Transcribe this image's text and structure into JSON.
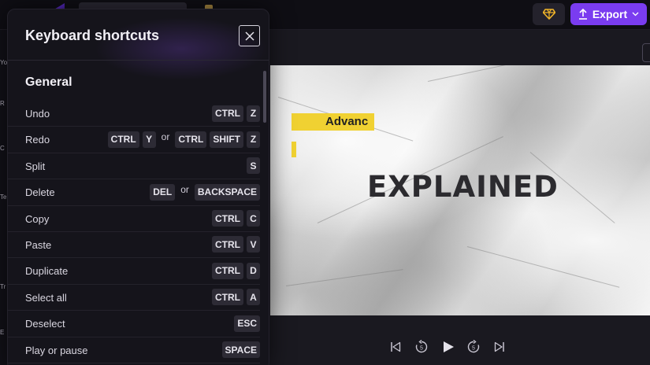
{
  "topbar": {
    "export_label": "Export",
    "icons": [
      "logo-icon",
      "diamond-icon",
      "upload-icon",
      "chevron-down-icon"
    ],
    "accent": "#7a3cf0",
    "premium_color": "#f0b429"
  },
  "rail": {
    "labels": [
      "Yo",
      "R",
      "C",
      "Te",
      "Tr",
      "E"
    ]
  },
  "preview": {
    "highlight_text": "Advanc",
    "headline": "EXPLAINED",
    "highlight_color": "#f0d132"
  },
  "controls": {
    "icons": [
      "skip-back-icon",
      "rewind-5-icon",
      "play-icon",
      "forward-5-icon",
      "skip-forward-icon"
    ],
    "rewind_label": "5",
    "forward_label": "5"
  },
  "panel": {
    "title": "Keyboard shortcuts",
    "section": "General",
    "rows": [
      {
        "name": "Undo",
        "groups": [
          [
            "CTRL",
            "Z"
          ]
        ]
      },
      {
        "name": "Redo",
        "groups": [
          [
            "CTRL",
            "Y"
          ],
          [
            "CTRL",
            "SHIFT",
            "Z"
          ]
        ]
      },
      {
        "name": "Split",
        "groups": [
          [
            "S"
          ]
        ]
      },
      {
        "name": "Delete",
        "groups": [
          [
            "DEL"
          ],
          [
            "BACKSPACE"
          ]
        ]
      },
      {
        "name": "Copy",
        "groups": [
          [
            "CTRL",
            "C"
          ]
        ]
      },
      {
        "name": "Paste",
        "groups": [
          [
            "CTRL",
            "V"
          ]
        ]
      },
      {
        "name": "Duplicate",
        "groups": [
          [
            "CTRL",
            "D"
          ]
        ]
      },
      {
        "name": "Select all",
        "groups": [
          [
            "CTRL",
            "A"
          ]
        ]
      },
      {
        "name": "Deselect",
        "groups": [
          [
            "ESC"
          ]
        ]
      },
      {
        "name": "Play or pause",
        "groups": [
          [
            "SPACE"
          ]
        ]
      }
    ],
    "or_label": "or"
  }
}
